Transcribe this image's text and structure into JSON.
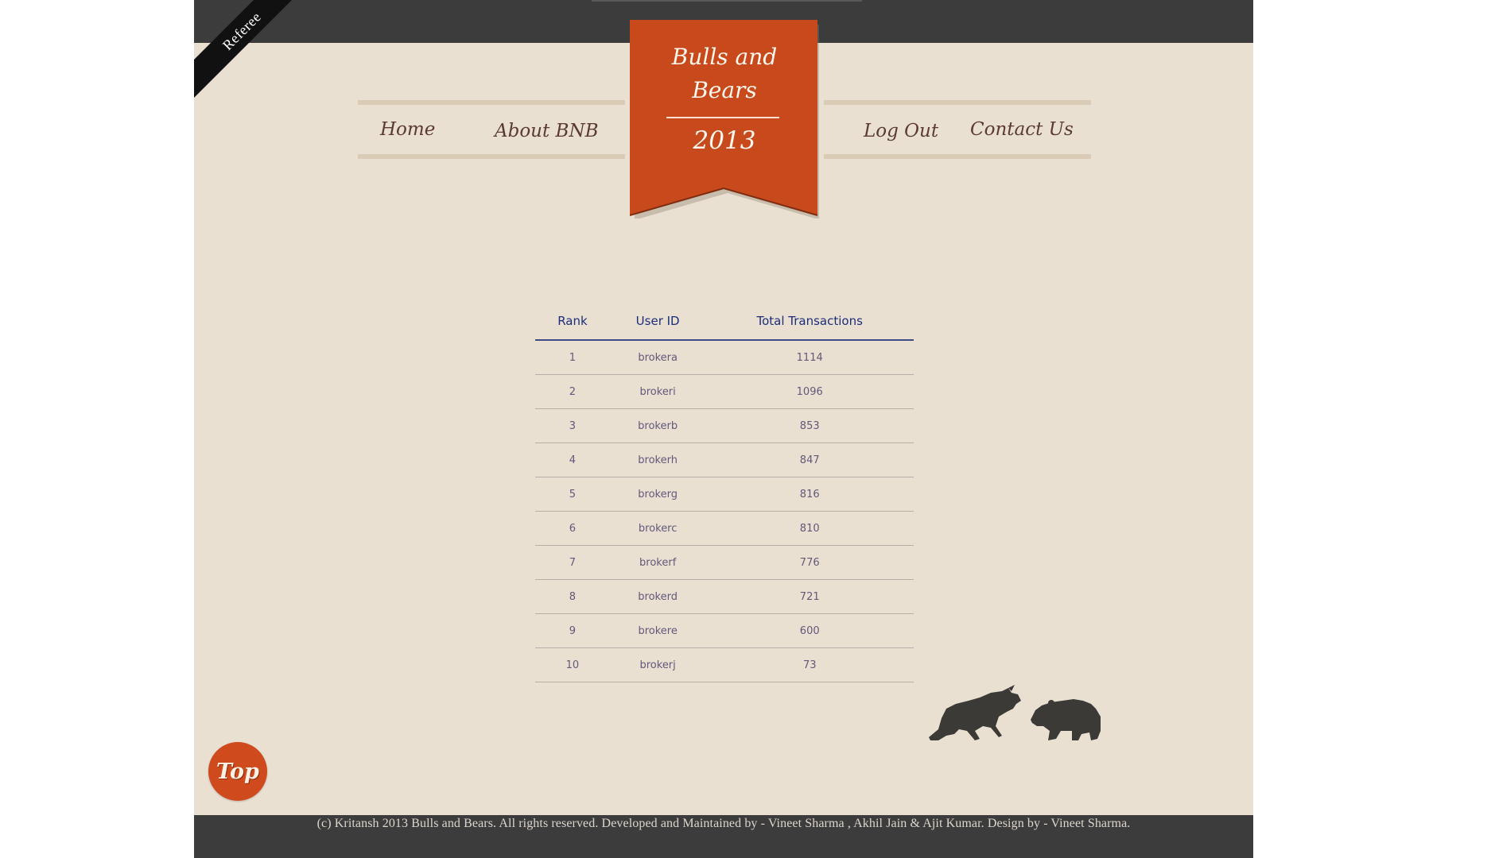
{
  "corner_ribbon": {
    "label": "Referee"
  },
  "nav": {
    "left": [
      {
        "label": "Home"
      },
      {
        "label": "About BNB"
      }
    ],
    "right": [
      {
        "label": "Log Out"
      },
      {
        "label": "Contact Us"
      }
    ]
  },
  "banner": {
    "title_line1": "Bulls and",
    "title_line2": "Bears",
    "year": "2013",
    "color": "#c84a1c"
  },
  "leaderboard": {
    "columns": [
      "Rank",
      "User ID",
      "Total Transactions"
    ],
    "rows": [
      {
        "rank": "1",
        "user": "brokera",
        "total": "1114"
      },
      {
        "rank": "2",
        "user": "brokeri",
        "total": "1096"
      },
      {
        "rank": "3",
        "user": "brokerb",
        "total": "853"
      },
      {
        "rank": "4",
        "user": "brokerh",
        "total": "847"
      },
      {
        "rank": "5",
        "user": "brokerg",
        "total": "816"
      },
      {
        "rank": "6",
        "user": "brokerc",
        "total": "810"
      },
      {
        "rank": "7",
        "user": "brokerf",
        "total": "776"
      },
      {
        "rank": "8",
        "user": "brokerd",
        "total": "721"
      },
      {
        "rank": "9",
        "user": "brokere",
        "total": "600"
      },
      {
        "rank": "10",
        "user": "brokerj",
        "total": "73"
      }
    ]
  },
  "top_button": {
    "label": "Top"
  },
  "footer": {
    "text": "(c) Kritansh 2013 Bulls and Bears. All rights reserved. Developed and Maintained by - Vineet Sharma , Akhil Jain & Ajit Kumar. Design by - Vineet Sharma."
  },
  "icons": {
    "bull": "bull-icon",
    "bear": "bear-icon"
  }
}
